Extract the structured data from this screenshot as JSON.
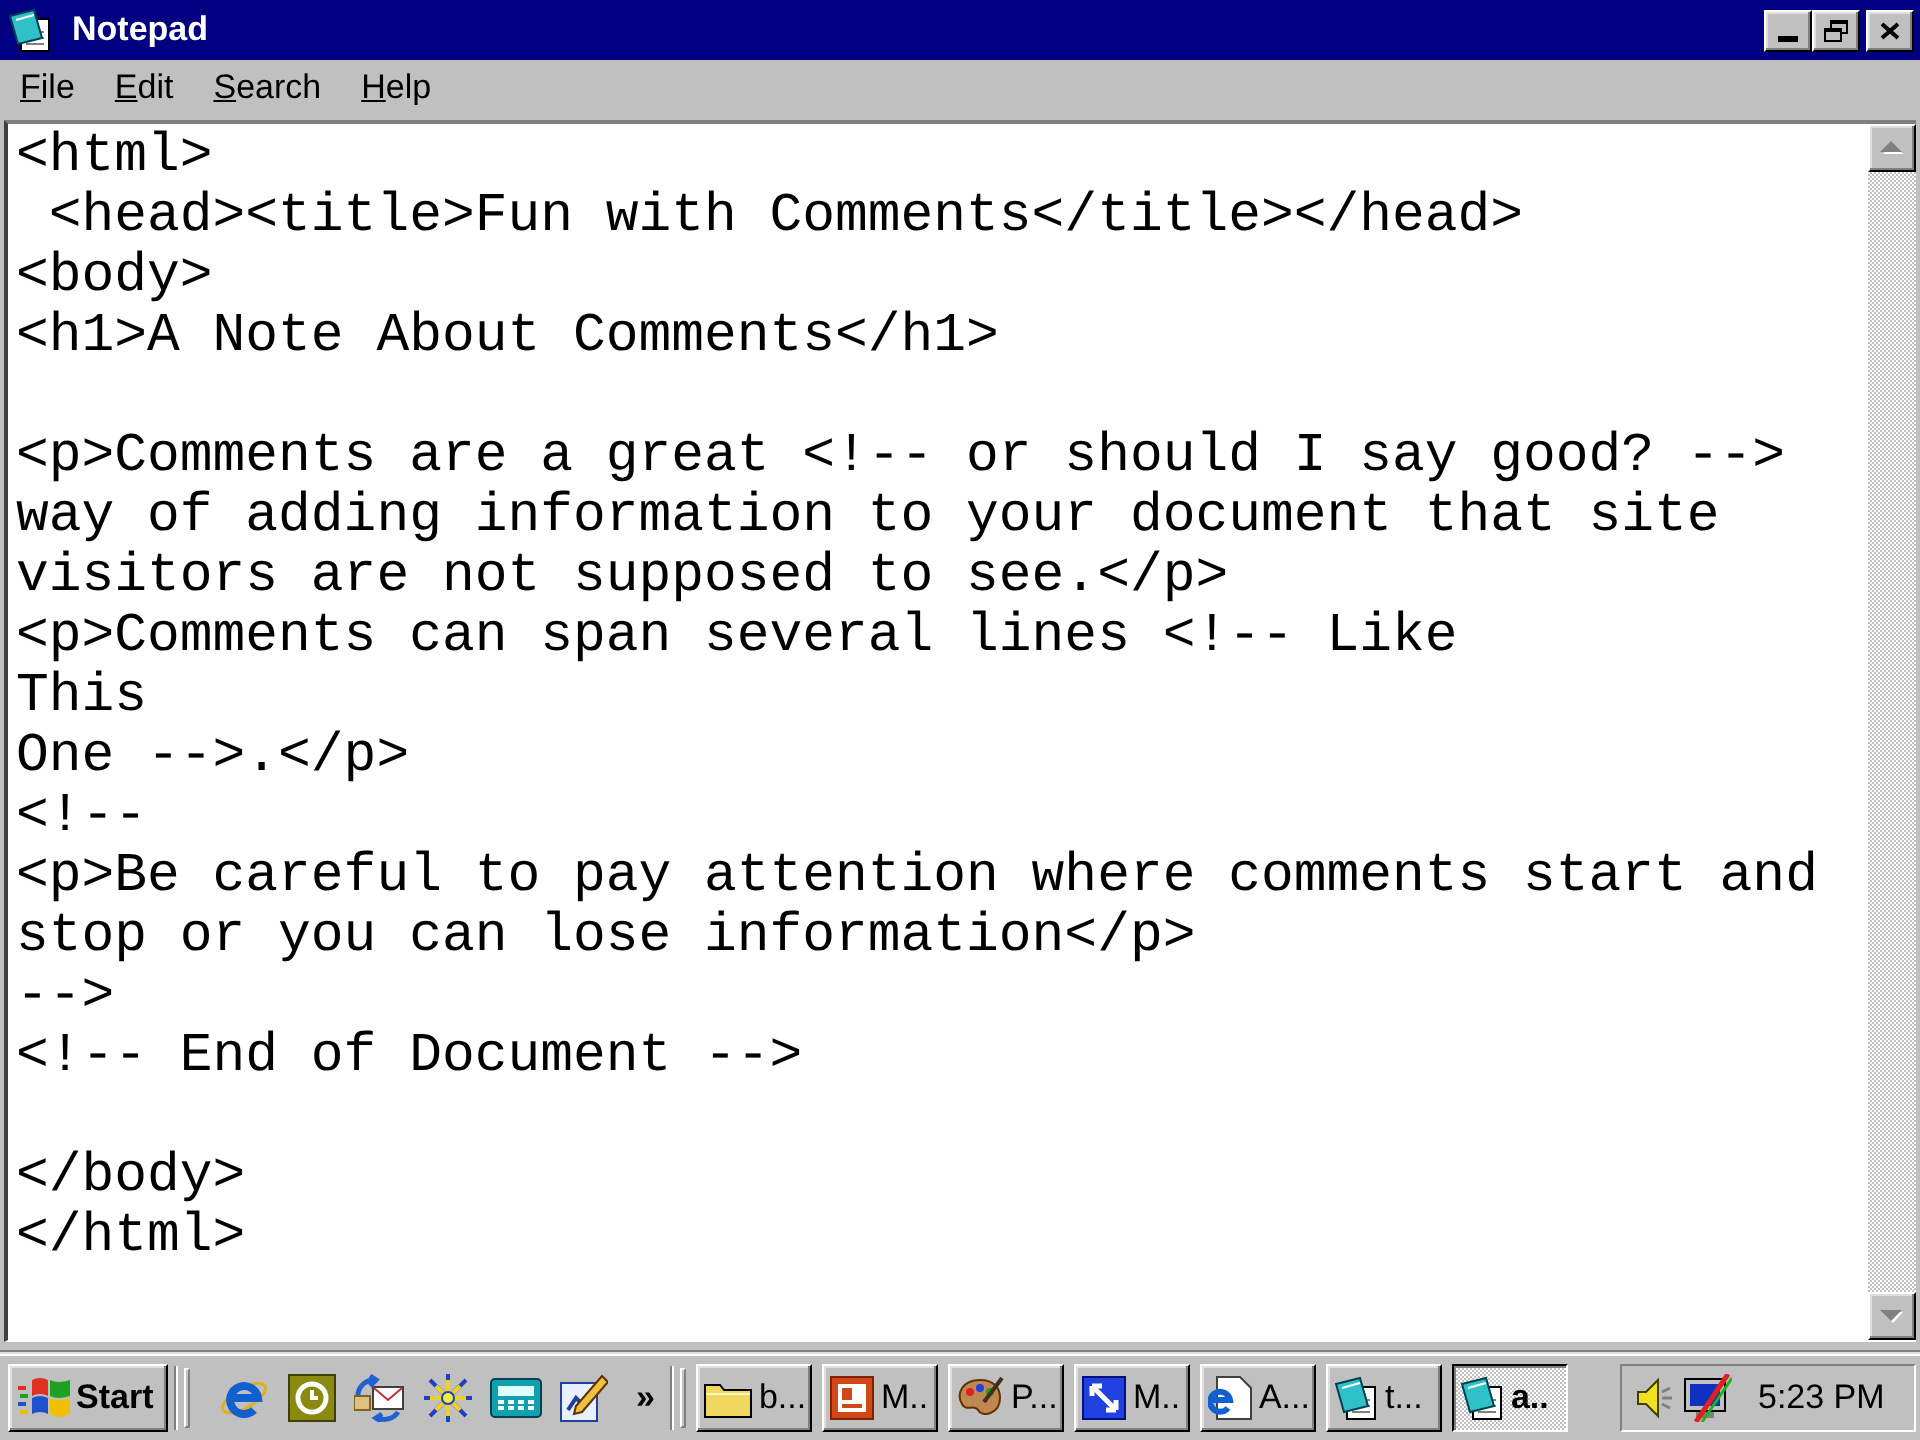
{
  "window": {
    "title": "Notepad"
  },
  "menu": [
    "File",
    "Edit",
    "Search",
    "Help"
  ],
  "document": {
    "blocks": [
      [
        "<html>",
        " <head><title>Fun with Comments</title></head>",
        "<body>",
        "<h1>A Note About Comments</h1>"
      ],
      [
        "<p>Comments are a great <!-- or should I say good? -->",
        "way of adding information to your document that site",
        "visitors are not supposed to see.</p>",
        "<p>Comments can span several lines <!-- Like",
        "This",
        "One -->.</p>",
        "<!--",
        "<p>Be careful to pay attention where comments start and",
        "stop or you can lose information</p>",
        "-->",
        "<!-- End of Document -->"
      ],
      [
        "</body>",
        "</html>"
      ]
    ]
  },
  "taskbar": {
    "start": "Start",
    "more": "»",
    "tasks": [
      {
        "label": "b...",
        "selected": false
      },
      {
        "label": "M..",
        "selected": false
      },
      {
        "label": "P...",
        "selected": false
      },
      {
        "label": "M..",
        "selected": false
      },
      {
        "label": "A...",
        "selected": false
      },
      {
        "label": "t...",
        "selected": false
      },
      {
        "label": "a..",
        "selected": true
      }
    ],
    "clock": "5:23 PM"
  }
}
